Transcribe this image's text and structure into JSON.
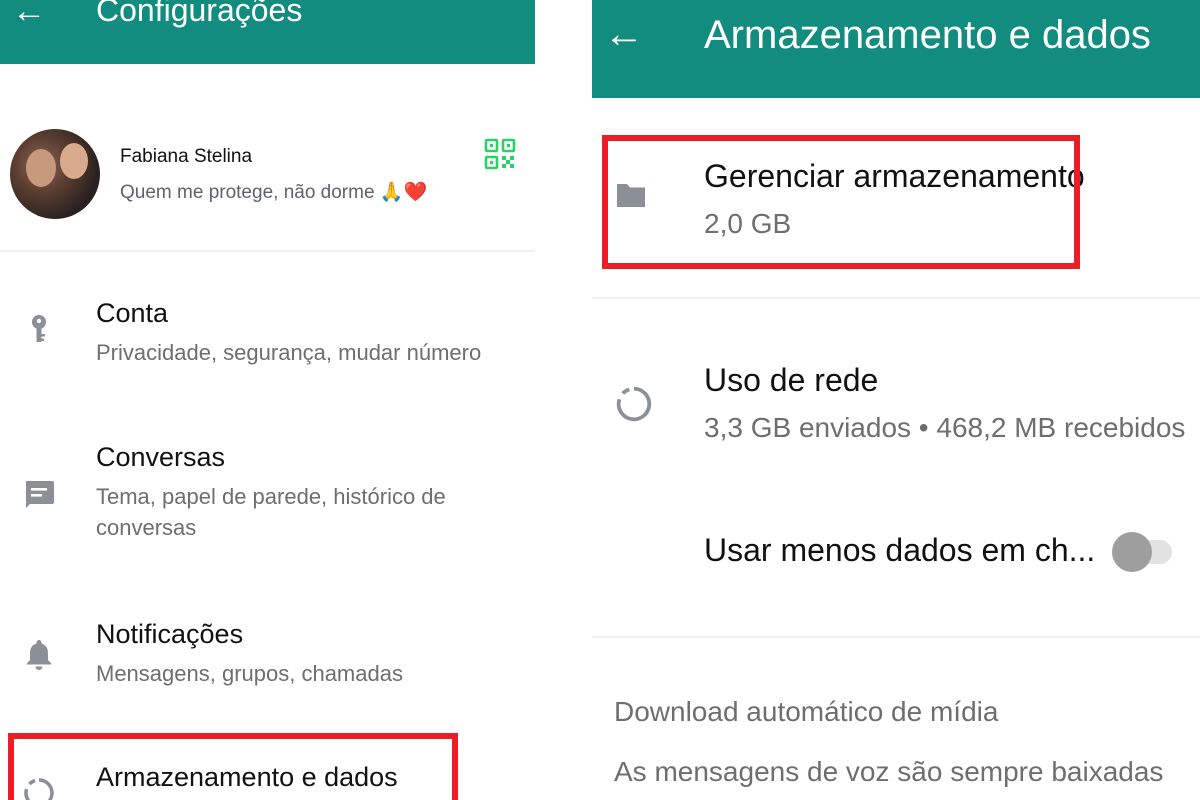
{
  "left": {
    "title": "Configurações",
    "profile": {
      "name": "Fabiana Stelina",
      "status": "Quem me protege, não dorme 🙏❤️"
    },
    "items": [
      {
        "title": "Conta",
        "subtitle": "Privacidade, segurança, mudar número",
        "icon": "key-icon"
      },
      {
        "title": "Conversas",
        "subtitle": "Tema, papel de parede, histórico de conversas",
        "icon": "chat-icon"
      },
      {
        "title": "Notificações",
        "subtitle": "Mensagens, grupos, chamadas",
        "icon": "bell-icon"
      },
      {
        "title": "Armazenamento e dados",
        "icon": "data-usage-icon"
      }
    ]
  },
  "right": {
    "title": "Armazenamento e dados",
    "manage": {
      "title": "Gerenciar armazenamento",
      "subtitle": "2,0 GB",
      "icon": "folder-icon"
    },
    "network": {
      "title": "Uso de rede",
      "subtitle": "3,3 GB enviados • 468,2 MB recebidos",
      "icon": "data-usage-icon"
    },
    "less_data": {
      "title": "Usar menos dados em ch...",
      "toggle_on": false
    },
    "auto_download": {
      "header": "Download automático de mídia",
      "description": "As mensagens de voz são sempre baixadas automaticamente"
    }
  },
  "colors": {
    "header": "#128c7e",
    "qr": "#25d366",
    "highlight": "#ee1c24",
    "icon": "#8a9096"
  }
}
